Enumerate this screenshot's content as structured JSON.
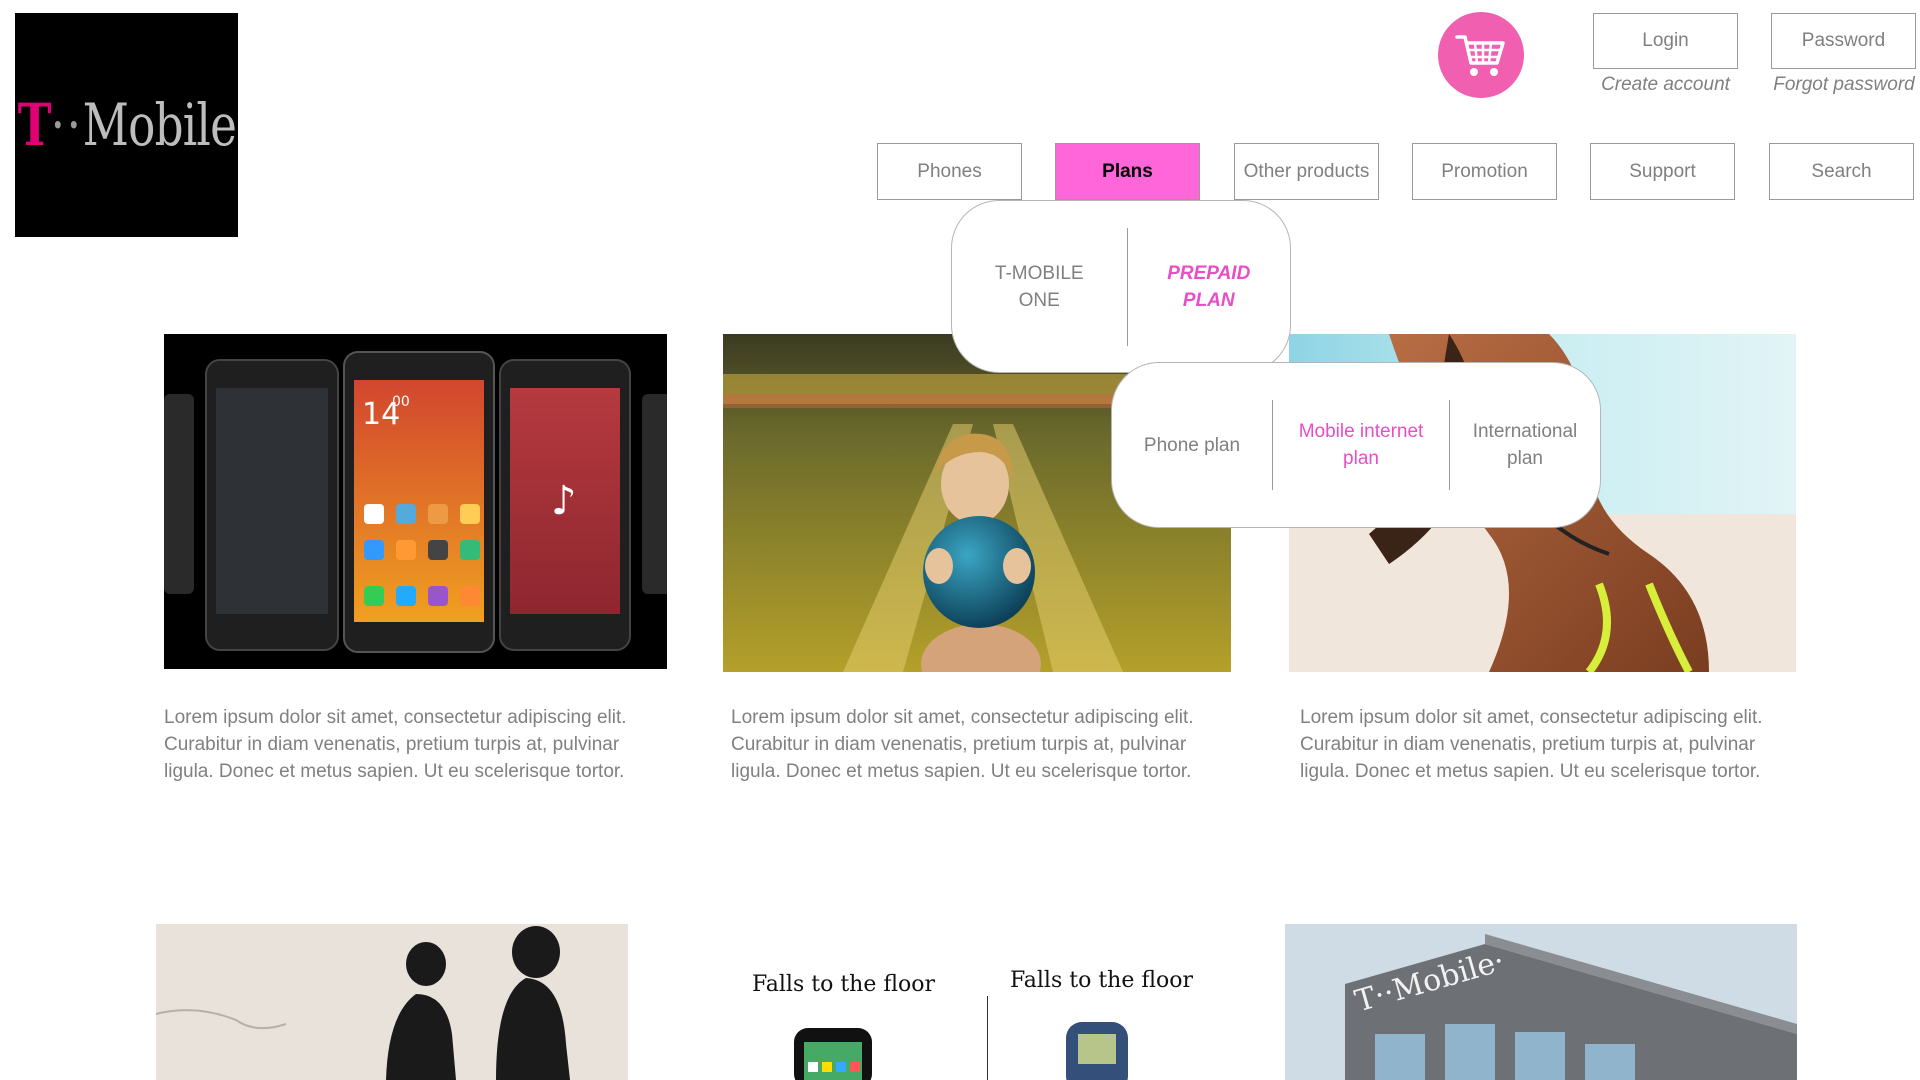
{
  "brand": {
    "logo_text_t": "T",
    "logo_text_rest": "Mobile",
    "logo_dots": "··",
    "pink": "#e20074"
  },
  "header": {
    "cart_icon": "shopping-cart-icon",
    "login_label": "Login",
    "password_label": "Password",
    "create_account": "Create account",
    "forgot_password": "Forgot password"
  },
  "nav": {
    "items": [
      {
        "label": "Phones"
      },
      {
        "label": "Plans",
        "active": true
      },
      {
        "label": "Other products"
      },
      {
        "label": "Promotion"
      },
      {
        "label": "Support"
      },
      {
        "label": "Search"
      }
    ]
  },
  "plans_menu": {
    "items": [
      {
        "label": "T-MOBILE ONE"
      },
      {
        "label": "PREPAID PLAN",
        "highlighted": true
      }
    ]
  },
  "prepaid_submenu": {
    "items": [
      {
        "label": "Phone plan"
      },
      {
        "label": "Mobile internet plan",
        "highlighted": true
      },
      {
        "label": "International plan"
      }
    ]
  },
  "cards": [
    {
      "text": "Lorem ipsum dolor sit amet, consectetur adipiscing elit. Curabitur in diam venenatis, pretium turpis at, pulvinar ligula. Donec et metus sapien. Ut eu scelerisque tortor."
    },
    {
      "text": "Lorem ipsum dolor sit amet, consectetur adipiscing elit. Curabitur in diam venenatis, pretium turpis at, pulvinar ligula. Donec et metus sapien. Ut eu scelerisque tortor."
    },
    {
      "text": "Lorem ipsum dolor sit amet, consectetur adipiscing elit. Curabitur in diam venenatis, pretium turpis at, pulvinar ligula. Donec et metus sapien. Ut eu scelerisque tortor."
    }
  ],
  "bottom": {
    "falls_left": "Falls to the floor",
    "falls_right": "Falls to the floor",
    "building_sign": "T··Mobile·"
  }
}
